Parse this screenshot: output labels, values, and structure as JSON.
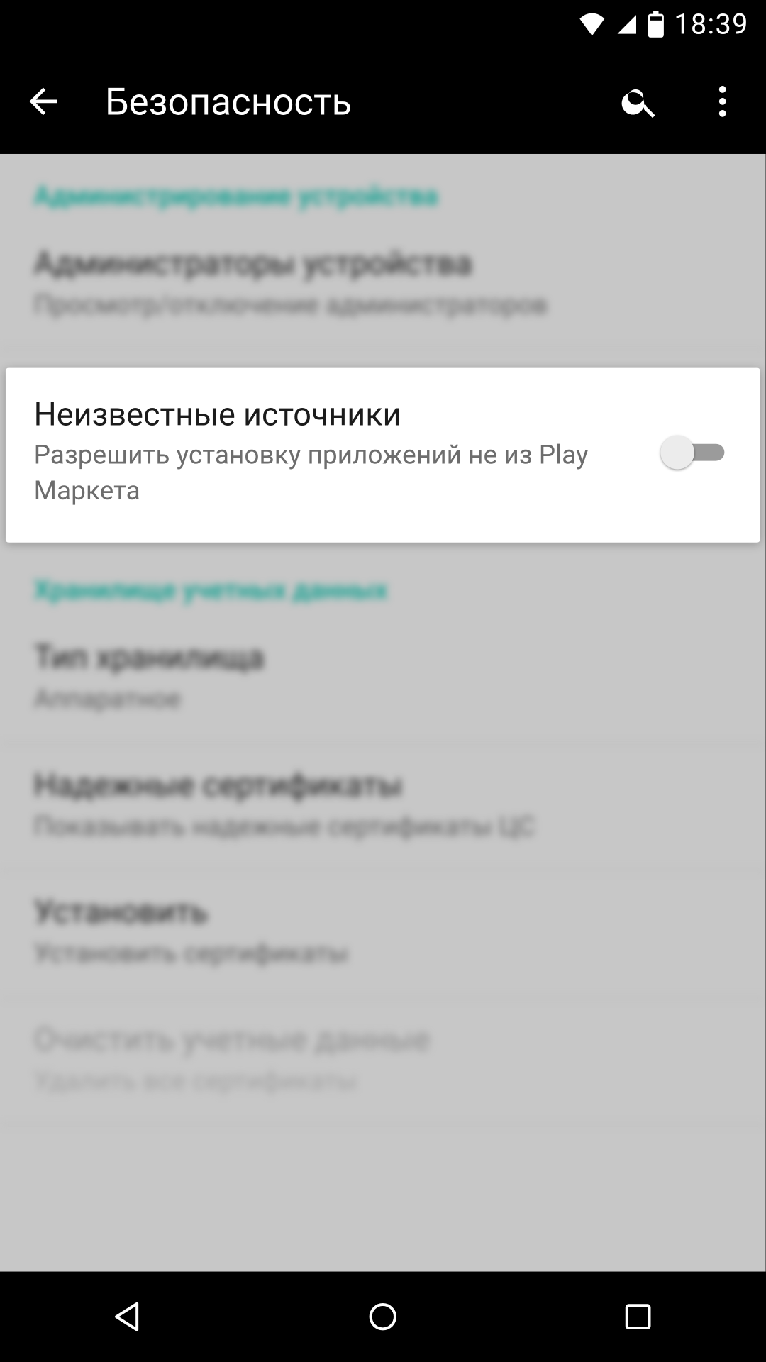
{
  "status": {
    "time": "18:39"
  },
  "header": {
    "title": "Безопасность"
  },
  "sections": {
    "admin": {
      "header": "Администрирование устройства",
      "item_admins": {
        "title": "Администраторы устройства",
        "sub": "Просмотр/отключение администраторов"
      }
    },
    "unknown": {
      "title": "Неизвестные источники",
      "sub": "Разрешить установку приложений не из Play Маркета",
      "toggle": false
    },
    "creds": {
      "header": "Хранилище учетных данных",
      "item_storage": {
        "title": "Тип хранилища",
        "sub": "Аппаратное"
      },
      "item_trusted": {
        "title": "Надежные сертификаты",
        "sub": "Показывать надежные сертификаты ЦС"
      },
      "item_install": {
        "title": "Установить",
        "sub": "Установить сертификаты"
      },
      "item_clear": {
        "title": "Очистить учетные данные",
        "sub": "Удалить все сертификаты"
      }
    }
  }
}
